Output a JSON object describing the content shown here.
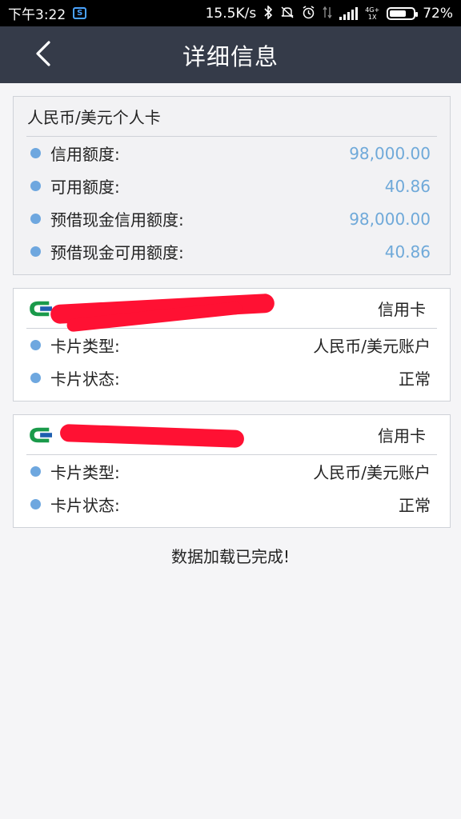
{
  "status_bar": {
    "time": "下午3:22",
    "net_speed": "15.5K/s",
    "net_type": "4G+\n1X",
    "battery": "72%",
    "battery_level": 0.72
  },
  "header": {
    "title": "详细信息",
    "back_icon": "chevron-left-icon"
  },
  "summary_card": {
    "title": "人民币/美元个人卡",
    "rows": [
      {
        "label": "信用额度:",
        "value": "98,000.00"
      },
      {
        "label": "可用额度:",
        "value": "40.86"
      },
      {
        "label": "预借现金信用额度:",
        "value": "98,000.00"
      },
      {
        "label": "预借现金可用额度:",
        "value": "40.86"
      }
    ]
  },
  "accounts": [
    {
      "type": "信用卡",
      "rows": [
        {
          "label": "卡片类型:",
          "value": "人民币/美元账户"
        },
        {
          "label": "卡片状态:",
          "value": "正常"
        }
      ]
    },
    {
      "type": "信用卡",
      "rows": [
        {
          "label": "卡片类型:",
          "value": "人民币/美元账户"
        },
        {
          "label": "卡片状态:",
          "value": "正常"
        }
      ]
    }
  ],
  "footer": {
    "status": "数据加载已完成!"
  },
  "colors": {
    "header_bg": "#353b49",
    "accent_value": "#6fa9d9",
    "dot": "#6ea7df",
    "redaction": "#ff1133"
  }
}
